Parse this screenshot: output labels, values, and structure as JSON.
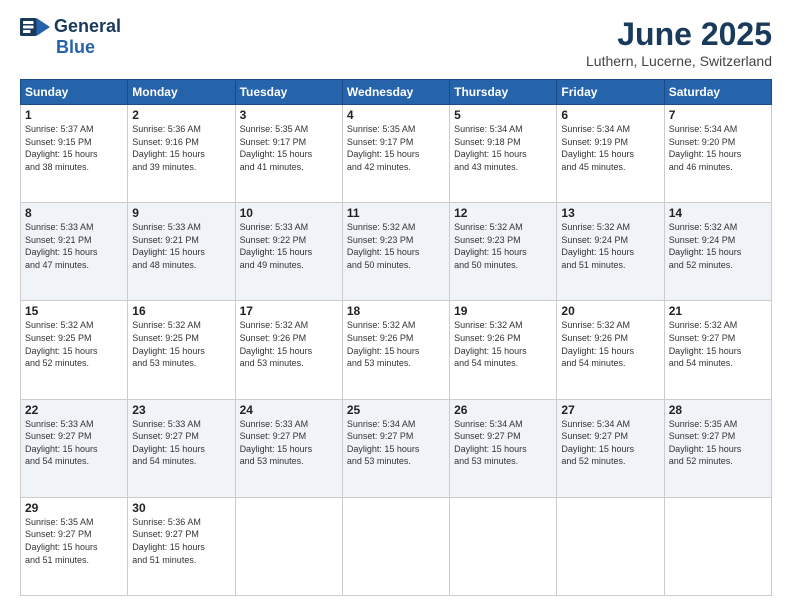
{
  "logo": {
    "line1": "General",
    "line2": "Blue"
  },
  "title": "June 2025",
  "subtitle": "Luthern, Lucerne, Switzerland",
  "weekdays": [
    "Sunday",
    "Monday",
    "Tuesday",
    "Wednesday",
    "Thursday",
    "Friday",
    "Saturday"
  ],
  "weeks": [
    [
      {
        "day": "1",
        "info": "Sunrise: 5:37 AM\nSunset: 9:15 PM\nDaylight: 15 hours\nand 38 minutes."
      },
      {
        "day": "2",
        "info": "Sunrise: 5:36 AM\nSunset: 9:16 PM\nDaylight: 15 hours\nand 39 minutes."
      },
      {
        "day": "3",
        "info": "Sunrise: 5:35 AM\nSunset: 9:17 PM\nDaylight: 15 hours\nand 41 minutes."
      },
      {
        "day": "4",
        "info": "Sunrise: 5:35 AM\nSunset: 9:17 PM\nDaylight: 15 hours\nand 42 minutes."
      },
      {
        "day": "5",
        "info": "Sunrise: 5:34 AM\nSunset: 9:18 PM\nDaylight: 15 hours\nand 43 minutes."
      },
      {
        "day": "6",
        "info": "Sunrise: 5:34 AM\nSunset: 9:19 PM\nDaylight: 15 hours\nand 45 minutes."
      },
      {
        "day": "7",
        "info": "Sunrise: 5:34 AM\nSunset: 9:20 PM\nDaylight: 15 hours\nand 46 minutes."
      }
    ],
    [
      {
        "day": "8",
        "info": "Sunrise: 5:33 AM\nSunset: 9:21 PM\nDaylight: 15 hours\nand 47 minutes."
      },
      {
        "day": "9",
        "info": "Sunrise: 5:33 AM\nSunset: 9:21 PM\nDaylight: 15 hours\nand 48 minutes."
      },
      {
        "day": "10",
        "info": "Sunrise: 5:33 AM\nSunset: 9:22 PM\nDaylight: 15 hours\nand 49 minutes."
      },
      {
        "day": "11",
        "info": "Sunrise: 5:32 AM\nSunset: 9:23 PM\nDaylight: 15 hours\nand 50 minutes."
      },
      {
        "day": "12",
        "info": "Sunrise: 5:32 AM\nSunset: 9:23 PM\nDaylight: 15 hours\nand 50 minutes."
      },
      {
        "day": "13",
        "info": "Sunrise: 5:32 AM\nSunset: 9:24 PM\nDaylight: 15 hours\nand 51 minutes."
      },
      {
        "day": "14",
        "info": "Sunrise: 5:32 AM\nSunset: 9:24 PM\nDaylight: 15 hours\nand 52 minutes."
      }
    ],
    [
      {
        "day": "15",
        "info": "Sunrise: 5:32 AM\nSunset: 9:25 PM\nDaylight: 15 hours\nand 52 minutes."
      },
      {
        "day": "16",
        "info": "Sunrise: 5:32 AM\nSunset: 9:25 PM\nDaylight: 15 hours\nand 53 minutes."
      },
      {
        "day": "17",
        "info": "Sunrise: 5:32 AM\nSunset: 9:26 PM\nDaylight: 15 hours\nand 53 minutes."
      },
      {
        "day": "18",
        "info": "Sunrise: 5:32 AM\nSunset: 9:26 PM\nDaylight: 15 hours\nand 53 minutes."
      },
      {
        "day": "19",
        "info": "Sunrise: 5:32 AM\nSunset: 9:26 PM\nDaylight: 15 hours\nand 54 minutes."
      },
      {
        "day": "20",
        "info": "Sunrise: 5:32 AM\nSunset: 9:26 PM\nDaylight: 15 hours\nand 54 minutes."
      },
      {
        "day": "21",
        "info": "Sunrise: 5:32 AM\nSunset: 9:27 PM\nDaylight: 15 hours\nand 54 minutes."
      }
    ],
    [
      {
        "day": "22",
        "info": "Sunrise: 5:33 AM\nSunset: 9:27 PM\nDaylight: 15 hours\nand 54 minutes."
      },
      {
        "day": "23",
        "info": "Sunrise: 5:33 AM\nSunset: 9:27 PM\nDaylight: 15 hours\nand 54 minutes."
      },
      {
        "day": "24",
        "info": "Sunrise: 5:33 AM\nSunset: 9:27 PM\nDaylight: 15 hours\nand 53 minutes."
      },
      {
        "day": "25",
        "info": "Sunrise: 5:34 AM\nSunset: 9:27 PM\nDaylight: 15 hours\nand 53 minutes."
      },
      {
        "day": "26",
        "info": "Sunrise: 5:34 AM\nSunset: 9:27 PM\nDaylight: 15 hours\nand 53 minutes."
      },
      {
        "day": "27",
        "info": "Sunrise: 5:34 AM\nSunset: 9:27 PM\nDaylight: 15 hours\nand 52 minutes."
      },
      {
        "day": "28",
        "info": "Sunrise: 5:35 AM\nSunset: 9:27 PM\nDaylight: 15 hours\nand 52 minutes."
      }
    ],
    [
      {
        "day": "29",
        "info": "Sunrise: 5:35 AM\nSunset: 9:27 PM\nDaylight: 15 hours\nand 51 minutes."
      },
      {
        "day": "30",
        "info": "Sunrise: 5:36 AM\nSunset: 9:27 PM\nDaylight: 15 hours\nand 51 minutes."
      },
      {
        "day": "",
        "info": ""
      },
      {
        "day": "",
        "info": ""
      },
      {
        "day": "",
        "info": ""
      },
      {
        "day": "",
        "info": ""
      },
      {
        "day": "",
        "info": ""
      }
    ]
  ]
}
